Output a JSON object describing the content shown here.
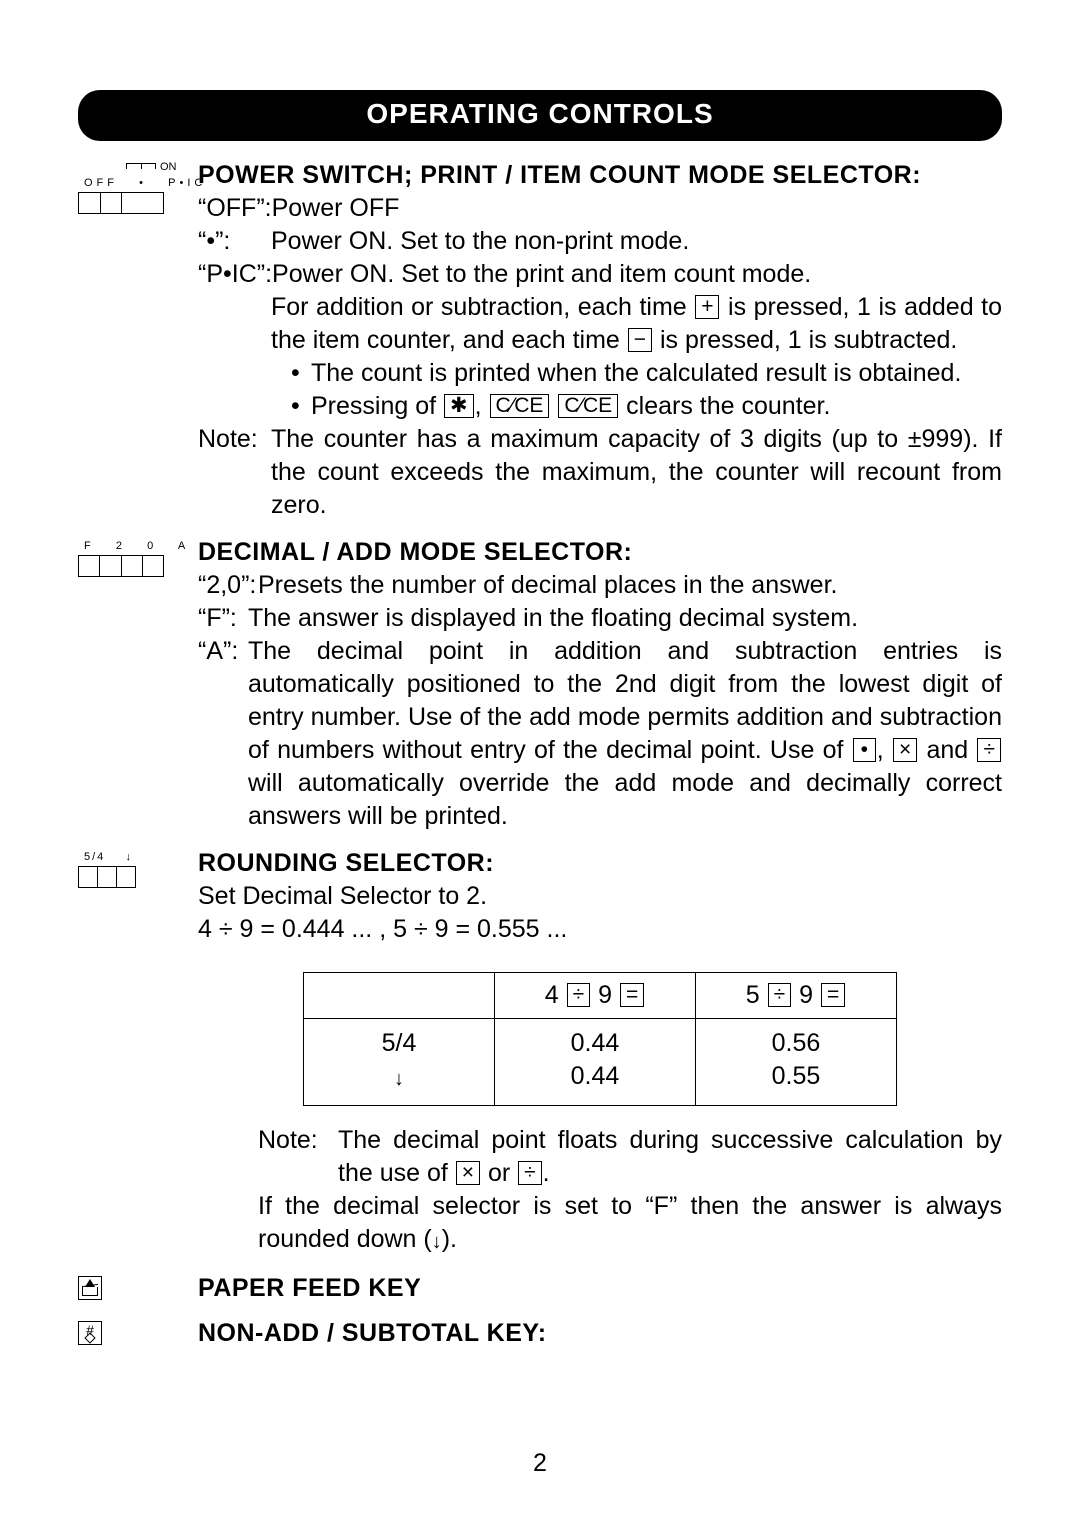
{
  "banner": "OPERATING CONTROLS",
  "power": {
    "switch_labels_top": "ON",
    "switch_labels_row": "OFF   •   P•IC",
    "title": "POWER SWITCH; PRINT / ITEM COUNT MODE SELECTOR:",
    "off_key": "“OFF”:",
    "off_val": "Power OFF",
    "dot_key": "“•”:",
    "dot_val": "Power ON. Set to the non-print mode.",
    "pic_key": "“P•IC”:",
    "pic_val": "Power ON. Set to the print and item count mode.",
    "pic_extra_1a": "For addition or subtraction, each time ",
    "pic_plus": "+",
    "pic_extra_1b": " is pressed, 1 is added to the item counter, and each time ",
    "pic_minus": "−",
    "pic_extra_1c": " is pressed, 1 is subtracted.",
    "bullet1": "The count is printed when the calculated result is obtained.",
    "bullet2a": "Pressing of ",
    "keys_clear": [
      "✱",
      "C⁄CE",
      "C⁄CE"
    ],
    "bullet2b": " clears the counter.",
    "note_key": "Note:",
    "note_val": "The counter has a maximum capacity of 3 digits (up to ±999). If the count exceeds the maximum, the counter will recount from zero."
  },
  "decimal": {
    "switch_labels_row": "F   2   0   A",
    "title": "DECIMAL / ADD MODE SELECTOR:",
    "k20": "“2,0”:",
    "v20": "Presets the number of decimal places in the answer.",
    "kF": "“F”:",
    "vF": "The answer is displayed in the floating decimal system.",
    "kA": "“A”:",
    "vA_1": "The decimal point in addition and subtraction entries is automatically positioned to the 2nd digit from the lowest digit of entry number. Use of the add mode permits addition and subtraction of numbers without entry of the decimal point. Use of ",
    "keys_override": [
      "•",
      "×",
      "÷"
    ],
    "vA_join": " and ",
    "vA_comma": ", ",
    "vA_2": " will automatically override the add mode and decimally correct answers  will be printed."
  },
  "rounding": {
    "switch_labels_row": "5/4    ↓",
    "title": "ROUNDING SELECTOR:",
    "line1": "Set Decimal Selector to 2.",
    "line2": "4 ÷ 9 = 0.444 ... , 5 ÷ 9 = 0.555 ...",
    "th1": "",
    "th2a": "4 ",
    "th2_div": "÷",
    "th2_mid": " 9 ",
    "th2_eq": "=",
    "th3a": "5 ",
    "th3_div": "÷",
    "th3_mid": " 9 ",
    "th3_eq": "=",
    "r1c1": "5/4",
    "r1c2": "0.44",
    "r1c3": "0.56",
    "r2c1": "↓",
    "r2c2": "0.44",
    "r2c3": "0.55",
    "note_key": "Note:",
    "note_val_a": "The decimal point floats during successive calculation by the use of ",
    "note_keys": [
      "×",
      "÷"
    ],
    "note_or": " or ",
    "note_val_b": ".",
    "after": "If the decimal selector is set to “F” then the answer is always rounded down (",
    "after_arrow": "↓",
    "after_end": ")."
  },
  "paper_feed_title": "PAPER FEED KEY",
  "nonadd_title": "NON-ADD / SUBTOTAL KEY:",
  "nonadd_hash": "#",
  "page_number": "2"
}
